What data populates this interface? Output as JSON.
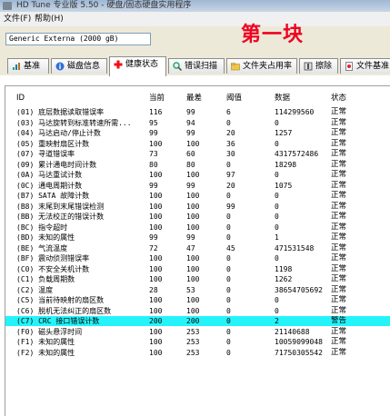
{
  "title": "HD Tune 专业版 5.50 - 硬盘/固态硬盘实用程序",
  "menu": {
    "file": "文件(F)",
    "help": "帮助(H)"
  },
  "watermark": "第一块",
  "drive": "Generic Externa   (2000 gB)",
  "tabs": [
    {
      "label": "基准",
      "icon": "benchmark-icon"
    },
    {
      "label": "磁盘信息",
      "icon": "disk-info-icon"
    },
    {
      "label": "健康状态",
      "icon": "health-cross-icon"
    },
    {
      "label": "错误扫描",
      "icon": "magnifier-icon"
    },
    {
      "label": "文件夹占用率",
      "icon": "folder-icon"
    },
    {
      "label": "擦除",
      "icon": "erase-icon"
    },
    {
      "label": "文件基准",
      "icon": "file-benchmark-icon"
    }
  ],
  "columns": [
    "ID",
    "当前",
    "最差",
    "阈值",
    "数据",
    "状态"
  ],
  "rows": [
    [
      "(01) 底层数据读取错误率",
      "116",
      "99",
      "6",
      "114299560",
      "正常"
    ],
    [
      "(03) 马达旋转到标准转速所需...",
      "95",
      "94",
      "0",
      "0",
      "正常"
    ],
    [
      "(04) 马达启动/停止计数",
      "99",
      "99",
      "20",
      "1257",
      "正常"
    ],
    [
      "(05) 重映射扇区计数",
      "100",
      "100",
      "36",
      "0",
      "正常"
    ],
    [
      "(07) 寻道错误率",
      "73",
      "60",
      "30",
      "4317572486",
      "正常"
    ],
    [
      "(09) 累计通电时间计数",
      "80",
      "80",
      "0",
      "18298",
      "正常"
    ],
    [
      "(0A) 马达重试计数",
      "100",
      "100",
      "97",
      "0",
      "正常"
    ],
    [
      "(0C) 通电周期计数",
      "99",
      "99",
      "20",
      "1075",
      "正常"
    ],
    [
      "(B7) SATA 故障计数",
      "100",
      "100",
      "0",
      "0",
      "正常"
    ],
    [
      "(B8) 末尾到末尾错误检测",
      "100",
      "100",
      "99",
      "0",
      "正常"
    ],
    [
      "(BB) 无法校正的错误计数",
      "100",
      "100",
      "0",
      "0",
      "正常"
    ],
    [
      "(BC) 指令超时",
      "100",
      "100",
      "0",
      "0",
      "正常"
    ],
    [
      "(BD) 未知的属性",
      "99",
      "99",
      "0",
      "1",
      "正常"
    ],
    [
      "(BE) 气流温度",
      "72",
      "47",
      "45",
      "471531548",
      "正常"
    ],
    [
      "(BF) 震动侦测错误率",
      "100",
      "100",
      "0",
      "0",
      "正常"
    ],
    [
      "(C0) 不安全关机计数",
      "100",
      "100",
      "0",
      "1198",
      "正常"
    ],
    [
      "(C1) 负载周期数",
      "100",
      "100",
      "0",
      "1262",
      "正常"
    ],
    [
      "(C2) 温度",
      "28",
      "53",
      "0",
      "38654705692",
      "正常"
    ],
    [
      "(C5) 当前待映射的扇区数",
      "100",
      "100",
      "0",
      "0",
      "正常"
    ],
    [
      "(C6) 脱机无法纠正的扇区数",
      "100",
      "100",
      "0",
      "0",
      "正常"
    ],
    [
      "(C7) CRC 接口错误计数",
      "200",
      "200",
      "0",
      "2",
      "警告"
    ],
    [
      "(F0) 磁头悬浮时间",
      "100",
      "253",
      "0",
      "21140688",
      "正常"
    ],
    [
      "(F1) 未知的属性",
      "100",
      "253",
      "0",
      "10059099048",
      "正常"
    ],
    [
      "(F2) 未知的属性",
      "100",
      "253",
      "0",
      "71750305542",
      "正常"
    ]
  ],
  "selected_row": 20,
  "colors": {
    "selection": "#25f3fa",
    "watermark": "#f00020"
  }
}
